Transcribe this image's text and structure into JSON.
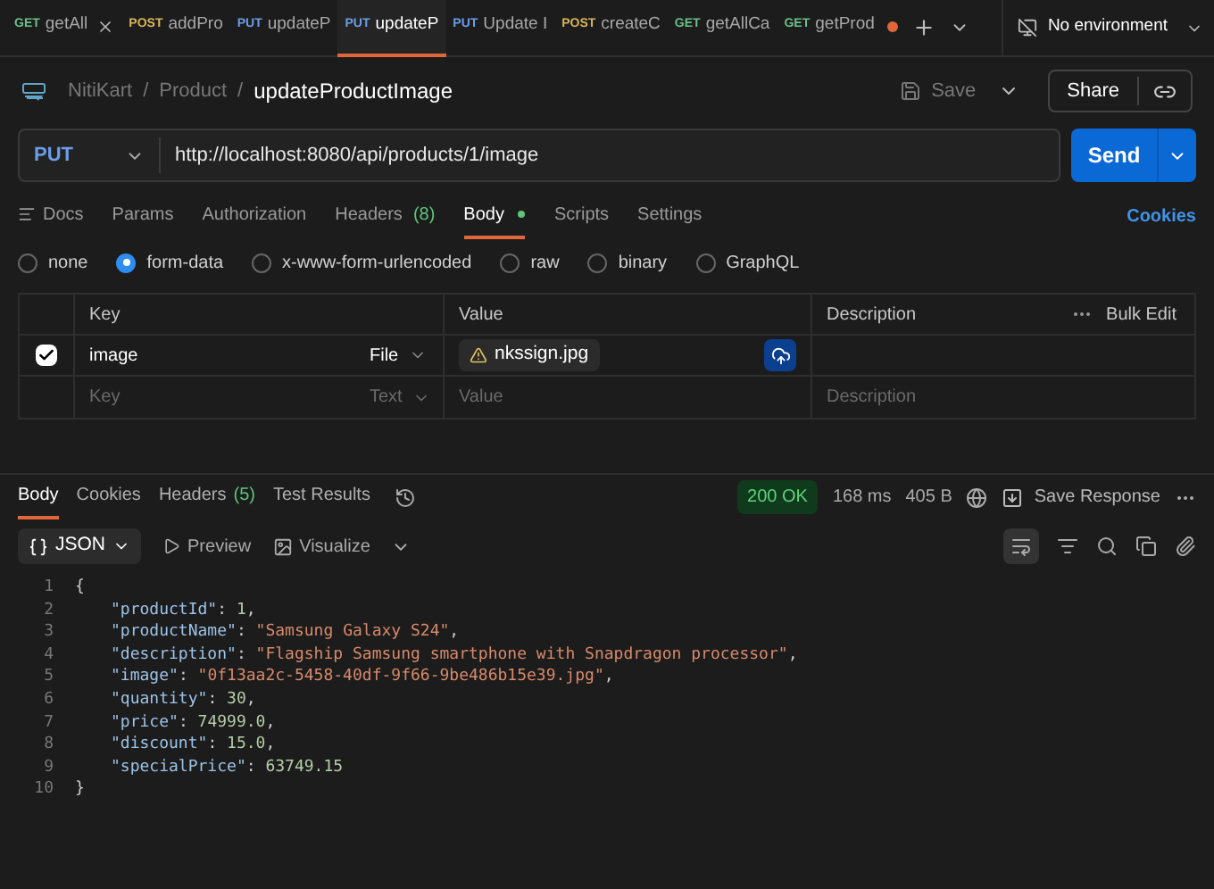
{
  "tabs": [
    {
      "method": "GET",
      "name": "getAll",
      "selected": false,
      "closable": true,
      "unsaved": false
    },
    {
      "method": "POST",
      "name": "addPro",
      "selected": false,
      "closable": false,
      "unsaved": false
    },
    {
      "method": "PUT",
      "name": "updateP",
      "selected": false,
      "closable": false,
      "unsaved": false
    },
    {
      "method": "PUT",
      "name": "updateP",
      "selected": true,
      "closable": false,
      "unsaved": false
    },
    {
      "method": "PUT",
      "name": "Update I",
      "selected": false,
      "closable": false,
      "unsaved": false
    },
    {
      "method": "POST",
      "name": "createC",
      "selected": false,
      "closable": false,
      "unsaved": false
    },
    {
      "method": "GET",
      "name": "getAllCa",
      "selected": false,
      "closable": false,
      "unsaved": false
    },
    {
      "method": "GET",
      "name": "getProd",
      "selected": false,
      "closable": false,
      "unsaved": true
    }
  ],
  "environment": "No environment",
  "breadcrumb": [
    {
      "text": "NitiKart"
    },
    {
      "separator": "/",
      "text": "Product"
    },
    {
      "separator": "/",
      "text": "updateProductImage"
    }
  ],
  "save": "Save",
  "share": "Share",
  "request": {
    "method": "PUT",
    "url": "http://localhost:8080/api/products/1/image",
    "send": "Send"
  },
  "request_tabs": [
    {
      "label": "Docs",
      "selected": false,
      "dot": false
    },
    {
      "label": "Params",
      "selected": false,
      "dot": false
    },
    {
      "label": "Authorization",
      "selected": false,
      "dot": false
    },
    {
      "label": "Headers",
      "count": "(8)",
      "selected": false,
      "dot": false
    },
    {
      "label": "Body",
      "selected": true,
      "dot": true
    },
    {
      "label": "Scripts",
      "selected": false,
      "dot": false
    },
    {
      "label": "Settings",
      "selected": false,
      "dot": false
    }
  ],
  "cookies": "Cookies",
  "body_types": [
    {
      "label": "none",
      "selected": false
    },
    {
      "label": "form-data",
      "selected": true
    },
    {
      "label": "x-www-form-urlencoded",
      "selected": false
    },
    {
      "label": "raw",
      "selected": false
    },
    {
      "label": "binary",
      "selected": false
    },
    {
      "label": "GraphQL",
      "selected": false
    }
  ],
  "table": {
    "columns": [
      "Key",
      "Value",
      "Description"
    ],
    "bulk_edit": "Bulk Edit",
    "rows": [
      {
        "checked": true,
        "key": "image",
        "type": "File",
        "file": "nkssign.jpg"
      }
    ],
    "empty_row": {
      "key": "Key",
      "type": "Text",
      "value": "Value",
      "description": "Description"
    }
  },
  "response_tabs": [
    {
      "label": "Body",
      "selected": true
    },
    {
      "label": "Cookies",
      "selected": false
    },
    {
      "label": "Headers",
      "count": "(5)",
      "selected": false
    },
    {
      "label": "Test Results",
      "selected": false
    }
  ],
  "status": "200 OK",
  "time": "168 ms",
  "size": "405 B",
  "save_response": "Save Response",
  "format": "JSON",
  "preview": "Preview",
  "visualize": "Visualize",
  "code_lines": [
    {
      "number": "1",
      "kind": "brace",
      "tokens": [
        {
          "kind": "punct",
          "text": "{"
        }
      ]
    },
    {
      "number": "2",
      "kind": "member",
      "tokens": [
        {
          "kind": "key",
          "text": "\"productId\""
        },
        {
          "kind": "punct",
          "text": ": "
        },
        {
          "kind": "number",
          "text": "1"
        },
        {
          "kind": "punct",
          "text": ","
        }
      ]
    },
    {
      "number": "3",
      "kind": "member",
      "tokens": [
        {
          "kind": "key",
          "text": "\"productName\""
        },
        {
          "kind": "punct",
          "text": ": "
        },
        {
          "kind": "string",
          "text": "\"Samsung Galaxy S24\""
        },
        {
          "kind": "punct",
          "text": ","
        }
      ]
    },
    {
      "number": "4",
      "kind": "member",
      "tokens": [
        {
          "kind": "key",
          "text": "\"description\""
        },
        {
          "kind": "punct",
          "text": ": "
        },
        {
          "kind": "string",
          "text": "\"Flagship Samsung smartphone with Snapdragon processor\""
        },
        {
          "kind": "punct",
          "text": ","
        }
      ]
    },
    {
      "number": "5",
      "kind": "member",
      "tokens": [
        {
          "kind": "key",
          "text": "\"image\""
        },
        {
          "kind": "punct",
          "text": ": "
        },
        {
          "kind": "string",
          "text": "\"0f13aa2c-5458-40df-9f66-9be486b15e39.jpg\""
        },
        {
          "kind": "punct",
          "text": ","
        }
      ]
    },
    {
      "number": "6",
      "kind": "member",
      "tokens": [
        {
          "kind": "key",
          "text": "\"quantity\""
        },
        {
          "kind": "punct",
          "text": ": "
        },
        {
          "kind": "number",
          "text": "30"
        },
        {
          "kind": "punct",
          "text": ","
        }
      ]
    },
    {
      "number": "7",
      "kind": "member",
      "tokens": [
        {
          "kind": "key",
          "text": "\"price\""
        },
        {
          "kind": "punct",
          "text": ": "
        },
        {
          "kind": "number",
          "text": "74999.0"
        },
        {
          "kind": "punct",
          "text": ","
        }
      ]
    },
    {
      "number": "8",
      "kind": "member",
      "tokens": [
        {
          "kind": "key",
          "text": "\"discount\""
        },
        {
          "kind": "punct",
          "text": ": "
        },
        {
          "kind": "number",
          "text": "15.0"
        },
        {
          "kind": "punct",
          "text": ","
        }
      ]
    },
    {
      "number": "9",
      "kind": "member",
      "tokens": [
        {
          "kind": "key",
          "text": "\"specialPrice\""
        },
        {
          "kind": "punct",
          "text": ": "
        },
        {
          "kind": "number",
          "text": "63749.15"
        }
      ]
    },
    {
      "number": "10",
      "kind": "brace",
      "tokens": [
        {
          "kind": "punct",
          "text": "}"
        }
      ]
    }
  ]
}
